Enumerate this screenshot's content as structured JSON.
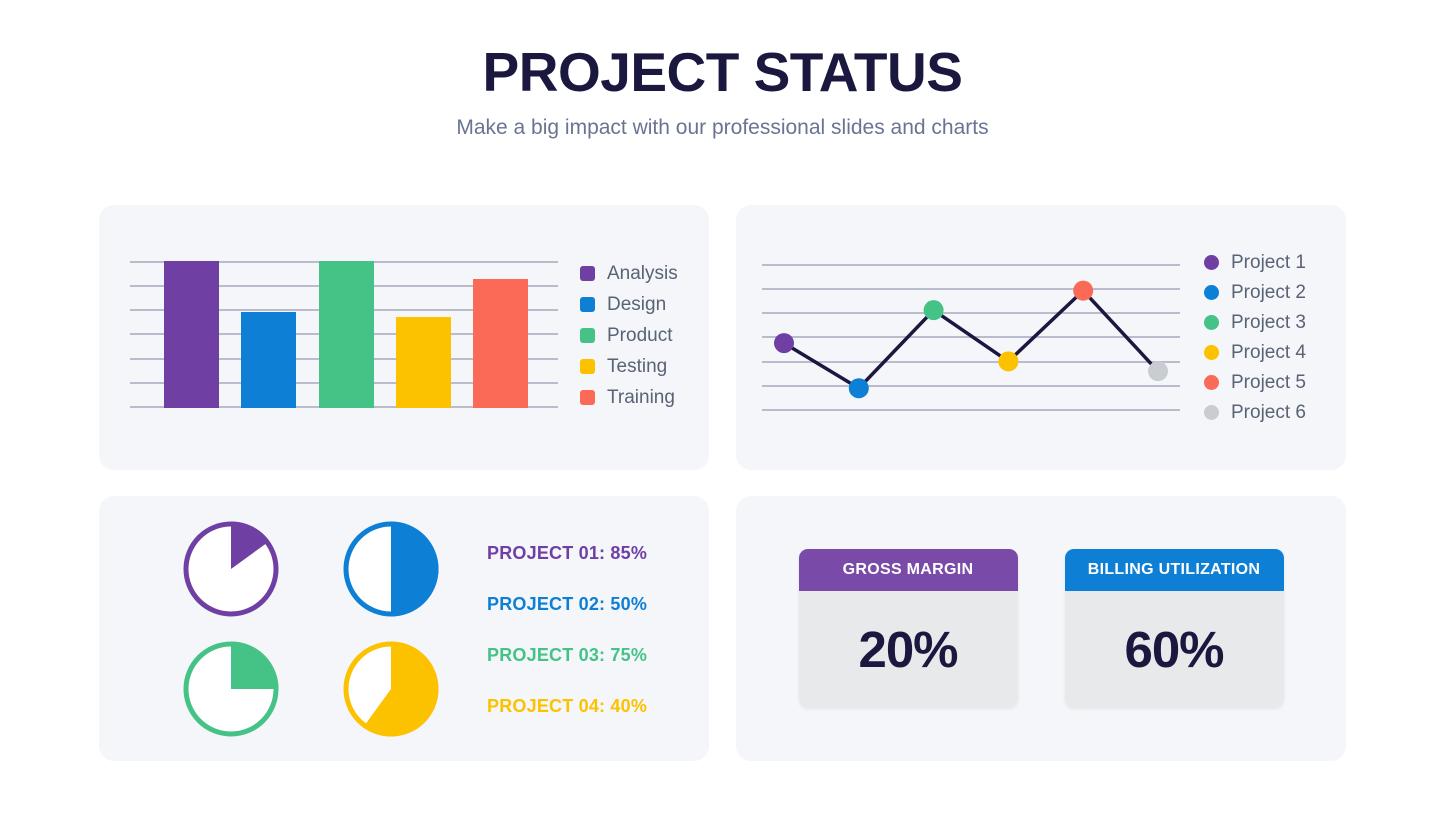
{
  "header": {
    "title": "PROJECT STATUS",
    "subtitle": "Make a big impact with our professional slides and charts"
  },
  "colors": {
    "purple": "#6f3fa3",
    "blue": "#0d7fd4",
    "green": "#45c387",
    "yellow": "#fcc200",
    "salmon": "#fb6a56",
    "gray": "#c9ccd1",
    "navy": "#1b1840",
    "gridline": "#b9bccd",
    "card_bg": "#f4f6f9",
    "kpi_body_bg": "#e8e9eb",
    "legend_text": "#5a6276",
    "subtitle_text": "#6b7393"
  },
  "chart_data": [
    {
      "type": "bar",
      "title": "",
      "xlabel": "",
      "ylabel": "",
      "grid": true,
      "gridline_count": 7,
      "legend_position": "right",
      "categories": [
        "Analysis",
        "Design",
        "Product",
        "Testing",
        "Training"
      ],
      "values": [
        100,
        65,
        100,
        62,
        88
      ],
      "ylim": [
        0,
        100
      ],
      "colors": [
        "#6f3fa3",
        "#0d7fd4",
        "#45c387",
        "#fcc200",
        "#fb6a56"
      ],
      "legend": [
        {
          "label": "Analysis",
          "color": "#6f3fa3"
        },
        {
          "label": "Design",
          "color": "#0d7fd4"
        },
        {
          "label": "Product",
          "color": "#45c387"
        },
        {
          "label": "Testing",
          "color": "#fcc200"
        },
        {
          "label": "Training",
          "color": "#fb6a56"
        }
      ]
    },
    {
      "type": "line",
      "title": "",
      "xlabel": "",
      "ylabel": "",
      "grid": true,
      "gridline_count": 7,
      "legend_position": "right",
      "line_color": "#1b1840",
      "categories": [
        "Project 1",
        "Project 2",
        "Project 3",
        "Project 4",
        "Project 5",
        "Project 6"
      ],
      "values": [
        45,
        8,
        72,
        30,
        88,
        22
      ],
      "ylim": [
        0,
        100
      ],
      "point_colors": [
        "#6f3fa3",
        "#0d7fd4",
        "#45c387",
        "#fcc200",
        "#fb6a56",
        "#c9ccd1"
      ],
      "legend": [
        {
          "label": "Project 1",
          "color": "#6f3fa3"
        },
        {
          "label": "Project 2",
          "color": "#0d7fd4"
        },
        {
          "label": "Project 3",
          "color": "#45c387"
        },
        {
          "label": "Project 4",
          "color": "#fcc200"
        },
        {
          "label": "Project 5",
          "color": "#fb6a56"
        },
        {
          "label": "Project 6",
          "color": "#c9ccd1"
        }
      ]
    },
    {
      "type": "pie",
      "title": "",
      "note": "Each circle shows the labelled percentage as the white (unfilled) portion",
      "slices": [
        {
          "label": "PROJECT 01: 85%",
          "value": 85,
          "filled_portion": 15,
          "color": "#6f3fa3"
        },
        {
          "label": "PROJECT 02: 50%",
          "value": 50,
          "filled_portion": 50,
          "color": "#0d7fd4"
        },
        {
          "label": "PROJECT 03: 75%",
          "value": 75,
          "filled_portion": 25,
          "color": "#45c387"
        },
        {
          "label": "PROJECT 04: 40%",
          "value": 40,
          "filled_portion": 60,
          "color": "#fcc200"
        }
      ]
    }
  ],
  "pie_labels": [
    {
      "text": "PROJECT 01: 85%",
      "color": "#6f3fa3"
    },
    {
      "text": "PROJECT 02: 50%",
      "color": "#0d7fd4"
    },
    {
      "text": "PROJECT 03: 75%",
      "color": "#45c387"
    },
    {
      "text": "PROJECT 04: 40%",
      "color": "#fcc200"
    }
  ],
  "kpis": [
    {
      "title": "GROSS MARGIN",
      "value": "20%",
      "header_color": "#7a4aa8"
    },
    {
      "title": "BILLING UTILIZATION",
      "value": "60%",
      "header_color": "#0d7fd4"
    }
  ]
}
